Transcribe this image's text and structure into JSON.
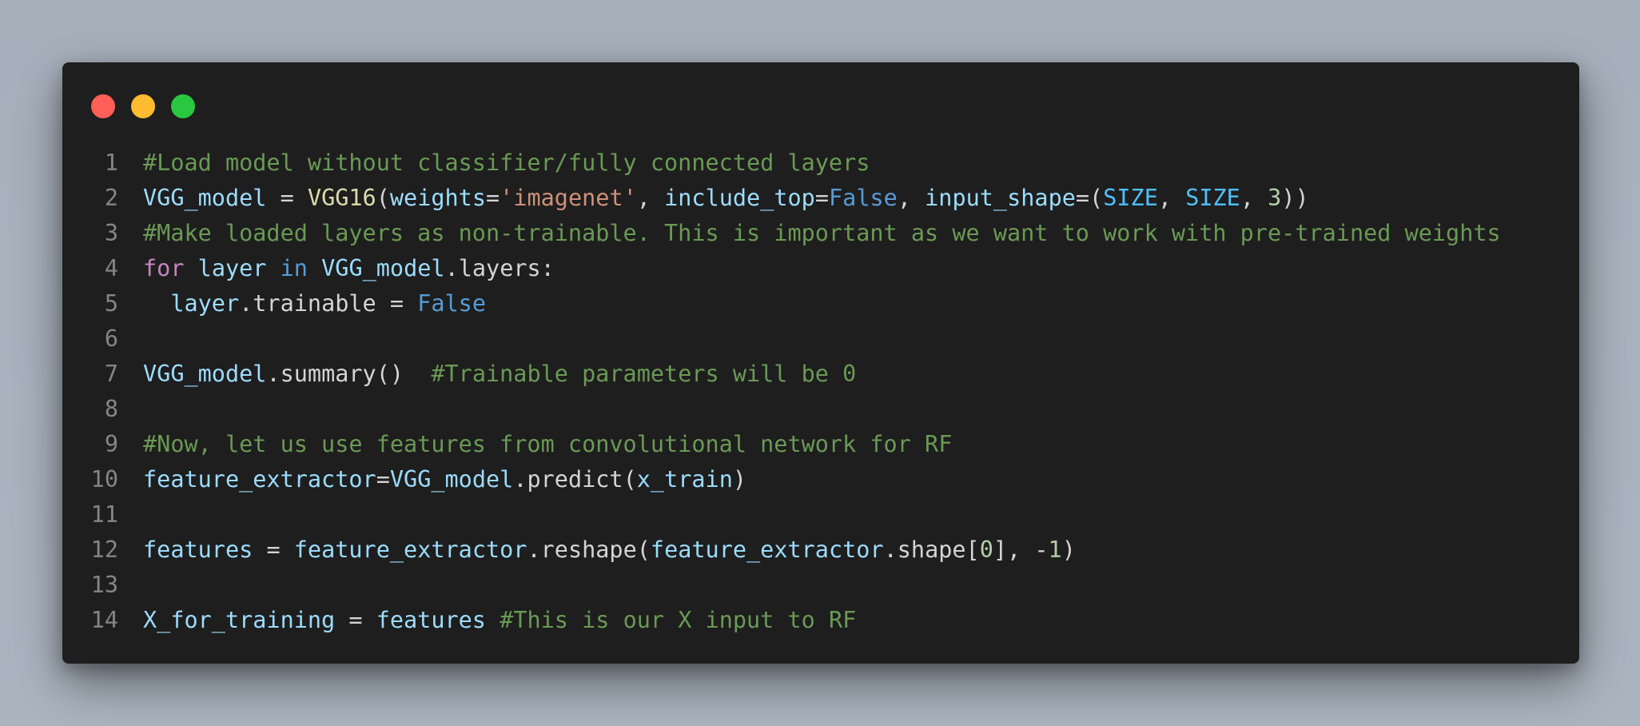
{
  "window": {
    "controls": [
      "close",
      "minimize",
      "maximize"
    ]
  },
  "colors": {
    "background": "#a7b1bc",
    "editor": "#1e1e1e",
    "close": "#ff5f57",
    "minimize": "#febc2e",
    "maximize": "#28c840",
    "comment": "#6a9955",
    "variable": "#9cdcfe",
    "function": "#dcdcaa",
    "string": "#ce9178",
    "keyword": "#569cd6",
    "control": "#c586c0",
    "number": "#b5cea8",
    "constant": "#4fc1ff",
    "line_number": "#858585"
  },
  "code": {
    "lines": [
      {
        "n": "1",
        "tokens": [
          {
            "t": "c-com",
            "v": "#Load model without classifier/fully connected layers"
          }
        ]
      },
      {
        "n": "2",
        "tokens": [
          {
            "t": "c-var",
            "v": "VGG_model"
          },
          {
            "t": "c-plain",
            "v": " = "
          },
          {
            "t": "c-fn",
            "v": "VGG16"
          },
          {
            "t": "c-plain",
            "v": "("
          },
          {
            "t": "c-var",
            "v": "weights"
          },
          {
            "t": "c-plain",
            "v": "="
          },
          {
            "t": "c-str",
            "v": "'imagenet'"
          },
          {
            "t": "c-plain",
            "v": ", "
          },
          {
            "t": "c-var",
            "v": "include_top"
          },
          {
            "t": "c-plain",
            "v": "="
          },
          {
            "t": "c-kw",
            "v": "False"
          },
          {
            "t": "c-plain",
            "v": ", "
          },
          {
            "t": "c-var",
            "v": "input_shape"
          },
          {
            "t": "c-plain",
            "v": "=("
          },
          {
            "t": "c-cst",
            "v": "SIZE"
          },
          {
            "t": "c-plain",
            "v": ", "
          },
          {
            "t": "c-cst",
            "v": "SIZE"
          },
          {
            "t": "c-plain",
            "v": ", "
          },
          {
            "t": "c-num",
            "v": "3"
          },
          {
            "t": "c-plain",
            "v": "))"
          }
        ]
      },
      {
        "n": "3",
        "tokens": [
          {
            "t": "c-com",
            "v": "#Make loaded layers as non-trainable. This is important as we want to work with pre-trained weights"
          }
        ]
      },
      {
        "n": "4",
        "tokens": [
          {
            "t": "c-ctl",
            "v": "for"
          },
          {
            "t": "c-plain",
            "v": " "
          },
          {
            "t": "c-var",
            "v": "layer"
          },
          {
            "t": "c-plain",
            "v": " "
          },
          {
            "t": "c-kw",
            "v": "in"
          },
          {
            "t": "c-plain",
            "v": " "
          },
          {
            "t": "c-var",
            "v": "VGG_model"
          },
          {
            "t": "c-plain",
            "v": ".layers:"
          }
        ]
      },
      {
        "n": "5",
        "tokens": [
          {
            "t": "c-plain",
            "v": "  "
          },
          {
            "t": "c-var",
            "v": "layer"
          },
          {
            "t": "c-plain",
            "v": ".trainable = "
          },
          {
            "t": "c-kw",
            "v": "False"
          }
        ]
      },
      {
        "n": "6",
        "tokens": []
      },
      {
        "n": "7",
        "tokens": [
          {
            "t": "c-var",
            "v": "VGG_model"
          },
          {
            "t": "c-plain",
            "v": ".summary()  "
          },
          {
            "t": "c-com",
            "v": "#Trainable parameters will be 0"
          }
        ]
      },
      {
        "n": "8",
        "tokens": []
      },
      {
        "n": "9",
        "tokens": [
          {
            "t": "c-com",
            "v": "#Now, let us use features from convolutional network for RF"
          }
        ]
      },
      {
        "n": "10",
        "tokens": [
          {
            "t": "c-var",
            "v": "feature_extractor"
          },
          {
            "t": "c-plain",
            "v": "="
          },
          {
            "t": "c-var",
            "v": "VGG_model"
          },
          {
            "t": "c-plain",
            "v": ".predict("
          },
          {
            "t": "c-var",
            "v": "x_train"
          },
          {
            "t": "c-plain",
            "v": ")"
          }
        ]
      },
      {
        "n": "11",
        "tokens": []
      },
      {
        "n": "12",
        "tokens": [
          {
            "t": "c-var",
            "v": "features"
          },
          {
            "t": "c-plain",
            "v": " = "
          },
          {
            "t": "c-var",
            "v": "feature_extractor"
          },
          {
            "t": "c-plain",
            "v": ".reshape("
          },
          {
            "t": "c-var",
            "v": "feature_extractor"
          },
          {
            "t": "c-plain",
            "v": ".shape["
          },
          {
            "t": "c-num",
            "v": "0"
          },
          {
            "t": "c-plain",
            "v": "], -"
          },
          {
            "t": "c-num",
            "v": "1"
          },
          {
            "t": "c-plain",
            "v": ")"
          }
        ]
      },
      {
        "n": "13",
        "tokens": []
      },
      {
        "n": "14",
        "tokens": [
          {
            "t": "c-var",
            "v": "X_for_training"
          },
          {
            "t": "c-plain",
            "v": " = "
          },
          {
            "t": "c-var",
            "v": "features"
          },
          {
            "t": "c-plain",
            "v": " "
          },
          {
            "t": "c-com",
            "v": "#This is our X input to RF"
          }
        ]
      }
    ]
  }
}
